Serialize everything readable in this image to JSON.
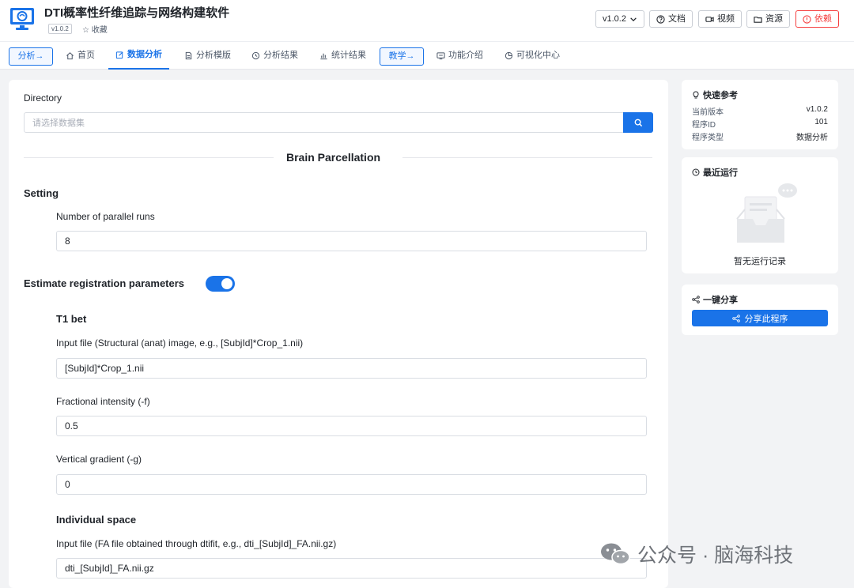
{
  "header": {
    "title": "DTI概率性纤维追踪与网络构建软件",
    "version_badge": "v1.0.2",
    "favorite": "☆ 收藏",
    "version_select": "v1.0.2",
    "docs": "文档",
    "video": "视频",
    "resources": "资源",
    "dependencies": "依赖"
  },
  "nav": {
    "analysis_tag": "分析→",
    "home": "首页",
    "data_analysis": "数据分析",
    "analysis_template": "分析模版",
    "analysis_results": "分析结果",
    "stat_results": "统计结果",
    "teaching_tag": "教学→",
    "features": "功能介绍",
    "viz_center": "可视化中心"
  },
  "form": {
    "directory_label": "Directory",
    "directory_placeholder": "请选择数据集",
    "section_title": "Brain Parcellation",
    "setting_heading": "Setting",
    "parallel_label": "Number of parallel runs",
    "parallel_value": "8",
    "estimate_heading": "Estimate registration parameters",
    "estimate_enabled": true,
    "t1bet_heading": "T1 bet",
    "input_label": "Input file (Structural (anat) image, e.g., [SubjId]*Crop_1.nii)",
    "input_value": "[SubjId]*Crop_1.nii",
    "frac_label": "Fractional intensity (-f)",
    "frac_value": "0.5",
    "vgrad_label": "Vertical gradient (-g)",
    "vgrad_value": "0",
    "individual_heading": "Individual space",
    "fa_label": "Input file (FA file obtained through dtifit, e.g., dti_[SubjId]_FA.nii.gz)",
    "fa_value": "dti_[SubjId]_FA.nii.gz"
  },
  "quick_ref": {
    "title": "快速参考",
    "rows": [
      {
        "k": "当前版本",
        "v": "v1.0.2"
      },
      {
        "k": "程序ID",
        "v": "101"
      },
      {
        "k": "程序类型",
        "v": "数据分析"
      }
    ]
  },
  "recent": {
    "title": "最近运行",
    "empty": "暂无运行记录"
  },
  "share": {
    "title": "一键分享",
    "button": "分享此程序"
  },
  "watermark": "公众号 · 脑海科技",
  "colors": {
    "accent": "#1a73e8",
    "danger": "#f53f3f"
  }
}
